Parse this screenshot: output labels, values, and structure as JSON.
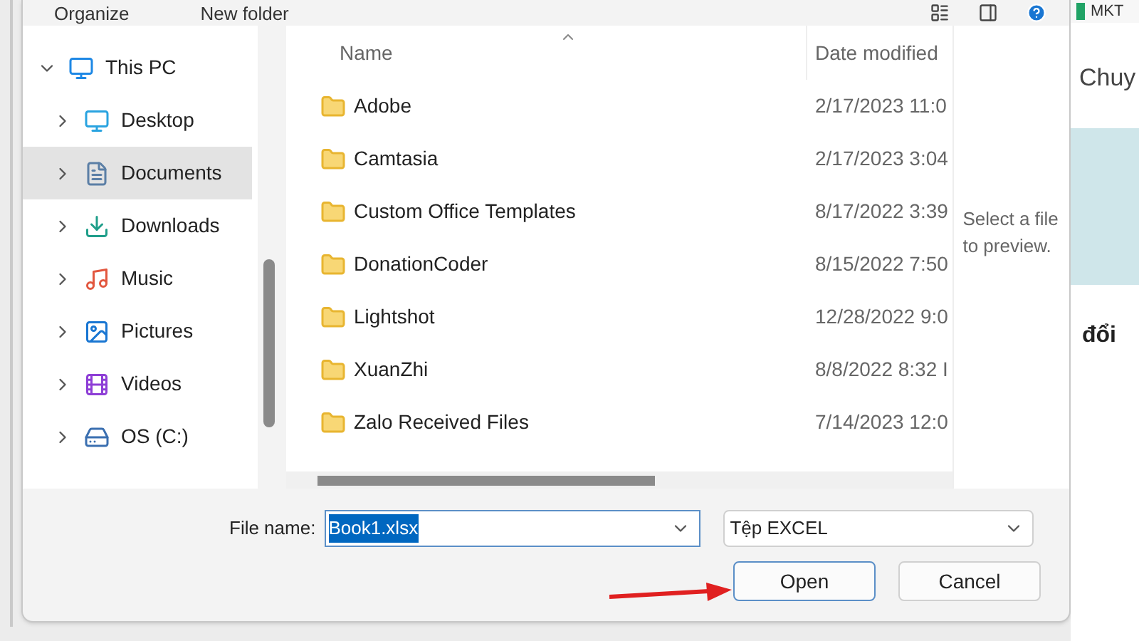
{
  "toolbar": [
    "Organize",
    "New folder"
  ],
  "nav": [
    {
      "label": "This PC",
      "kind": "pc",
      "expanded": true,
      "selected": false,
      "children": [
        {
          "label": "Desktop",
          "kind": "desktop",
          "expanded": false,
          "selected": false
        },
        {
          "label": "Documents",
          "kind": "documents",
          "expanded": false,
          "selected": true
        },
        {
          "label": "Downloads",
          "kind": "downloads",
          "expanded": false,
          "selected": false
        },
        {
          "label": "Music",
          "kind": "music",
          "expanded": false,
          "selected": false
        },
        {
          "label": "Pictures",
          "kind": "pictures",
          "expanded": false,
          "selected": false
        },
        {
          "label": "Videos",
          "kind": "videos",
          "expanded": false,
          "selected": false
        },
        {
          "label": "OS (C:)",
          "kind": "drive",
          "expanded": false,
          "selected": false
        }
      ]
    }
  ],
  "columns": [
    "Name",
    "Date modified"
  ],
  "rows": [
    {
      "name": "Adobe",
      "date": "2/17/2023 11:0"
    },
    {
      "name": "Camtasia",
      "date": "2/17/2023 3:04"
    },
    {
      "name": "Custom Office Templates",
      "date": "8/17/2022 3:39"
    },
    {
      "name": "DonationCoder",
      "date": "8/15/2022 7:50"
    },
    {
      "name": "Lightshot",
      "date": "12/28/2022 9:0"
    },
    {
      "name": "XuanZhi",
      "date": "8/8/2022 8:32 I"
    },
    {
      "name": "Zalo Received Files",
      "date": "7/14/2023 12:0"
    }
  ],
  "preview": "Select a file to preview.",
  "file_name": {
    "label": "File name:",
    "value": "Book1.xlsx",
    "value_selected": true
  },
  "file_type": "Tệp EXCEL",
  "buttons": [
    {
      "label": "Open",
      "default": true
    },
    {
      "label": "Cancel",
      "default": false
    }
  ],
  "background": {
    "tab": "MKT",
    "heading": "Chuy",
    "word": "đổi"
  }
}
